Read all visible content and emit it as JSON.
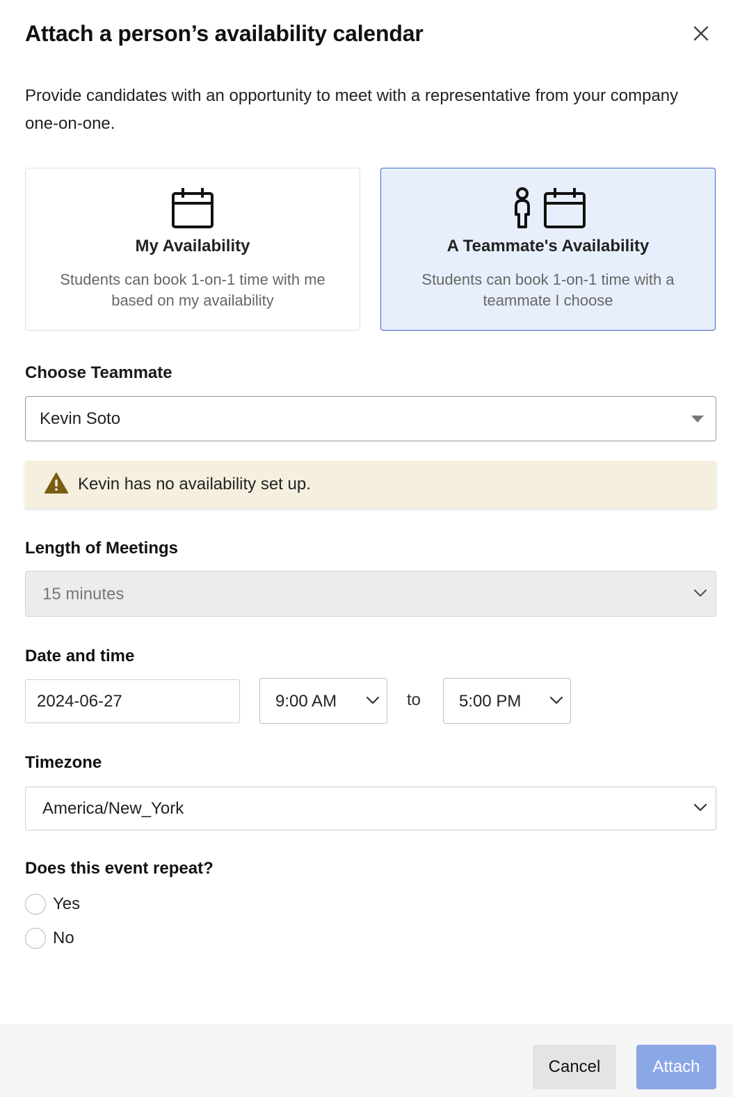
{
  "dialog": {
    "title": "Attach a person’s availability calendar",
    "intro": "Provide candidates with an opportunity to meet with a representative from your company one-on-one."
  },
  "options": {
    "mine": {
      "title": "My Availability",
      "description": "Students can book 1-on-1 time with me based on my availability",
      "icon": "calendar-icon"
    },
    "teammate": {
      "title": "A Teammate's Availability",
      "description": "Students can book 1-on-1 time with a teammate I choose",
      "icon": "person-calendar-icon",
      "selected": true
    }
  },
  "teammate": {
    "label": "Choose Teammate",
    "value": "Kevin Soto"
  },
  "alert": {
    "message": "Kevin has no availability set up.",
    "color": "#f5efdf",
    "icon_color": "#7a5c12"
  },
  "length": {
    "label": "Length of Meetings",
    "value": "15 minutes"
  },
  "datetime": {
    "label": "Date and time",
    "date": "2024-06-27",
    "start": "9:00 AM",
    "separator": "to",
    "end": "5:00 PM"
  },
  "timezone": {
    "label": "Timezone",
    "value": "America/New_York"
  },
  "repeat": {
    "label": "Does this event repeat?",
    "options": [
      "Yes",
      "No"
    ]
  },
  "footer": {
    "cancel": "Cancel",
    "attach": "Attach",
    "accent": "#8aa7e6"
  }
}
